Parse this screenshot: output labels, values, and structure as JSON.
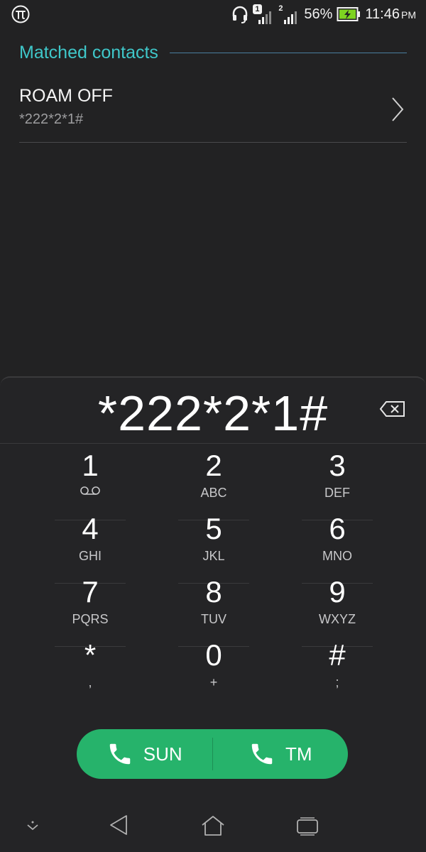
{
  "status_bar": {
    "sim1_badge": "1",
    "sim2_badge": "2",
    "battery": "56%",
    "time": "11:46",
    "ampm": "PM"
  },
  "matched_contacts": {
    "title": "Matched contacts",
    "contacts": [
      {
        "name": "ROAM OFF",
        "number": "*222*2*1#"
      }
    ]
  },
  "dialer": {
    "display_number": "*222*2*1#",
    "keys": [
      {
        "digit": "1",
        "letters": ""
      },
      {
        "digit": "2",
        "letters": "ABC"
      },
      {
        "digit": "3",
        "letters": "DEF"
      },
      {
        "digit": "4",
        "letters": "GHI"
      },
      {
        "digit": "5",
        "letters": "JKL"
      },
      {
        "digit": "6",
        "letters": "MNO"
      },
      {
        "digit": "7",
        "letters": "PQRS"
      },
      {
        "digit": "8",
        "letters": "TUV"
      },
      {
        "digit": "9",
        "letters": "WXYZ"
      },
      {
        "digit": "*",
        "letters": ","
      },
      {
        "digit": "0",
        "letters": "+"
      },
      {
        "digit": "#",
        "letters": ";"
      }
    ]
  },
  "call_buttons": {
    "sim1_label": "SUN",
    "sim2_label": "TM"
  },
  "colors": {
    "accent": "#3fc7c9",
    "call_green": "#26b36b",
    "background": "#222223"
  },
  "icons": {
    "status": [
      "pi-logo-icon",
      "headset-icon",
      "signal-icon",
      "battery-charging-icon"
    ],
    "keypad": [
      "voicemail-icon",
      "backspace-icon",
      "phone-icon",
      "chevron-right-icon"
    ],
    "navigation": [
      "collapse-icon",
      "back-icon",
      "home-icon",
      "recent-apps-icon"
    ]
  }
}
